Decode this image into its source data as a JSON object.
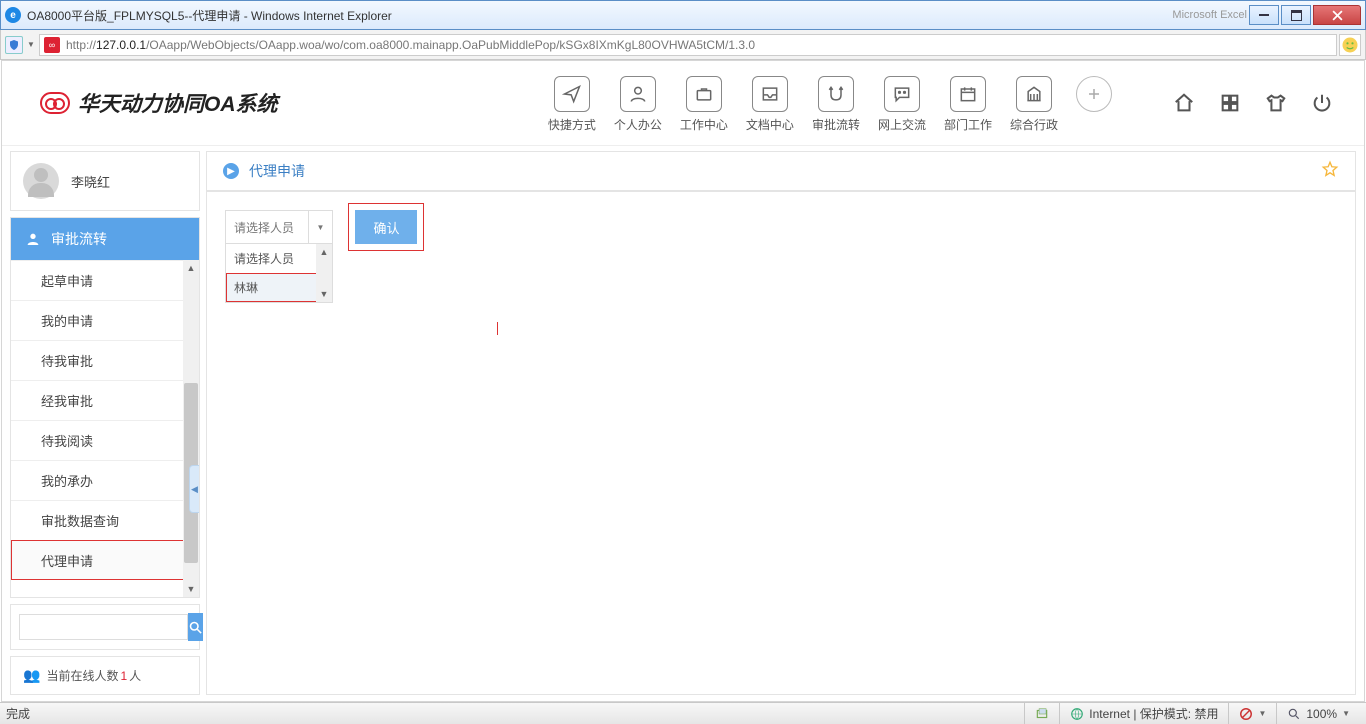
{
  "window": {
    "title": "OA8000平台版_FPLMYSQL5--代理申请 - Windows Internet Explorer",
    "ghost_app": "Microsoft Excel"
  },
  "address": {
    "prefix": "http://",
    "host": "127.0.0.1",
    "path": "/OAapp/WebObjects/OAapp.woa/wo/com.oa8000.mainapp.OaPubMiddlePop/kSGx8IXmKgL80OVHWA5tCM/1.3.0"
  },
  "logo_text": "华天动力协同OA系统",
  "topnav": [
    {
      "label": "快捷方式"
    },
    {
      "label": "个人办公"
    },
    {
      "label": "工作中心"
    },
    {
      "label": "文档中心"
    },
    {
      "label": "审批流转"
    },
    {
      "label": "网上交流"
    },
    {
      "label": "部门工作"
    },
    {
      "label": "综合行政"
    },
    {
      "label": ""
    }
  ],
  "user": {
    "name": "李晓红"
  },
  "sidebar": {
    "section_title": "审批流转",
    "items": [
      {
        "label": "起草申请"
      },
      {
        "label": "我的申请"
      },
      {
        "label": "待我审批"
      },
      {
        "label": "经我审批"
      },
      {
        "label": "待我阅读"
      },
      {
        "label": "我的承办"
      },
      {
        "label": "审批数据查询"
      },
      {
        "label": "代理申请"
      }
    ]
  },
  "online": {
    "prefix": "当前在线人数 ",
    "count": "1",
    "suffix": "人"
  },
  "main": {
    "title": "代理申请",
    "select_placeholder": "请选择人员",
    "options": [
      {
        "label": "请选择人员"
      },
      {
        "label": "林琳"
      }
    ],
    "confirm": "确认"
  },
  "status": {
    "done": "完成",
    "zone": "Internet | 保护模式: 禁用",
    "zoom": "100%"
  }
}
